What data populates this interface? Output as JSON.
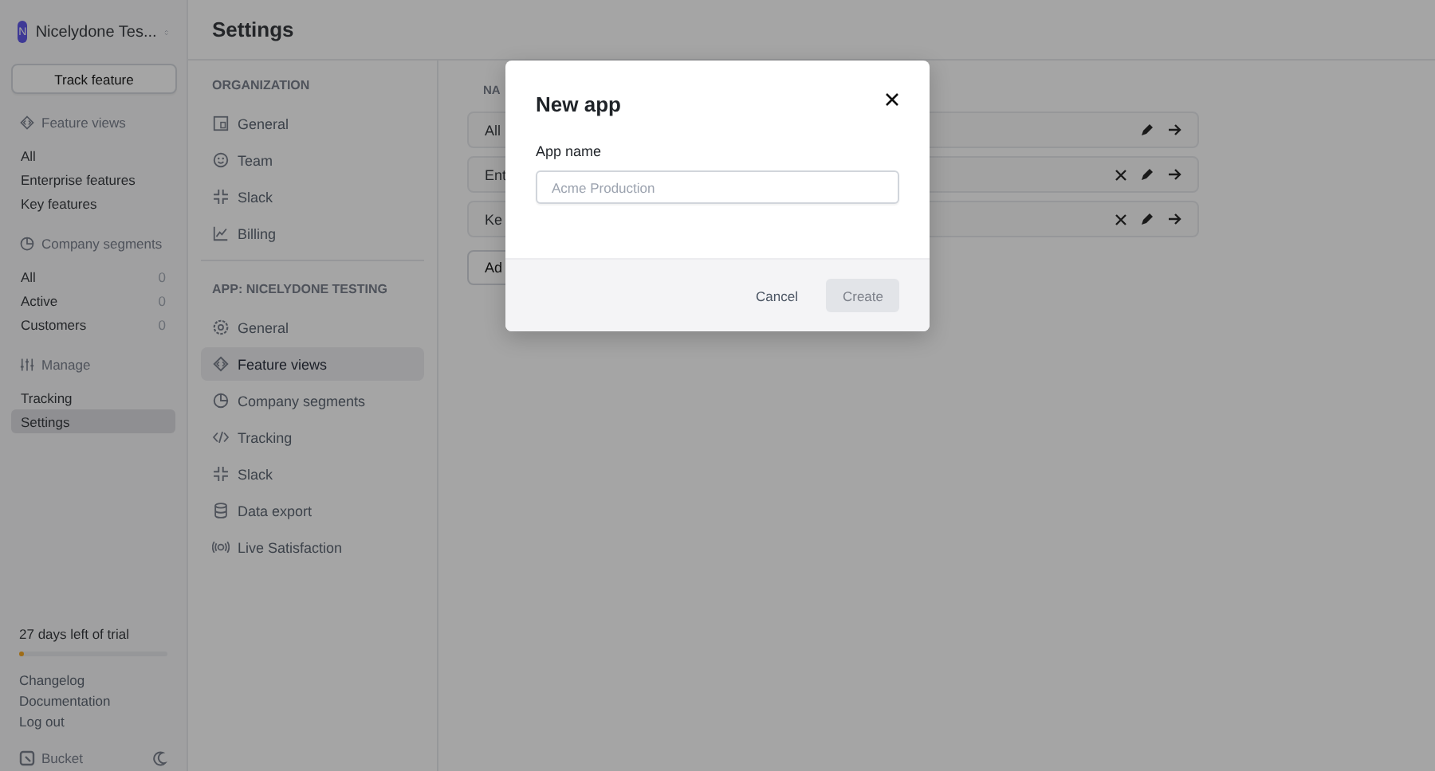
{
  "workspace": {
    "initial": "N",
    "name": "Nicelydone Tes..."
  },
  "track_button": "Track feature",
  "sidebar_sections": [
    {
      "title": "Feature views",
      "items": [
        {
          "label": "All",
          "selected": false
        },
        {
          "label": "Enterprise features",
          "selected": false
        },
        {
          "label": "Key features",
          "selected": false
        }
      ]
    },
    {
      "title": "Company segments",
      "items": [
        {
          "label": "All",
          "count": "0",
          "selected": false
        },
        {
          "label": "Active",
          "count": "0",
          "selected": false
        },
        {
          "label": "Customers",
          "count": "0",
          "selected": false
        }
      ]
    },
    {
      "title": "Manage",
      "items": [
        {
          "label": "Tracking",
          "selected": false
        },
        {
          "label": "Settings",
          "selected": true
        }
      ]
    }
  ],
  "trial": {
    "text": "27 days left of trial",
    "level": 0.02
  },
  "footer_links": [
    "Changelog",
    "Documentation",
    "Log out"
  ],
  "brand": "Bucket",
  "page_title": "Settings",
  "settings_nav": [
    {
      "heading": "ORGANIZATION",
      "items": [
        {
          "label": "General",
          "selected": false
        },
        {
          "label": "Team",
          "selected": false
        },
        {
          "label": "Slack",
          "selected": false
        },
        {
          "label": "Billing",
          "selected": false
        }
      ]
    },
    {
      "heading": "APP: NICELYDONE TESTING",
      "items": [
        {
          "label": "General",
          "selected": false
        },
        {
          "label": "Feature views",
          "selected": true
        },
        {
          "label": "Company segments",
          "selected": false
        },
        {
          "label": "Tracking",
          "selected": false
        },
        {
          "label": "Slack",
          "selected": false
        },
        {
          "label": "Data export",
          "selected": false
        },
        {
          "label": "Live Satisfaction",
          "selected": false
        }
      ]
    }
  ],
  "feature_views": {
    "column_header": "NA",
    "rows": [
      {
        "name": "All",
        "deletable": false
      },
      {
        "name": "Ent",
        "deletable": true
      },
      {
        "name": "Ke",
        "deletable": true
      }
    ],
    "add_button": "Ad"
  },
  "modal": {
    "title": "New app",
    "field_label": "App name",
    "placeholder": "Acme Production",
    "cancel": "Cancel",
    "create": "Create",
    "create_disabled": true
  }
}
